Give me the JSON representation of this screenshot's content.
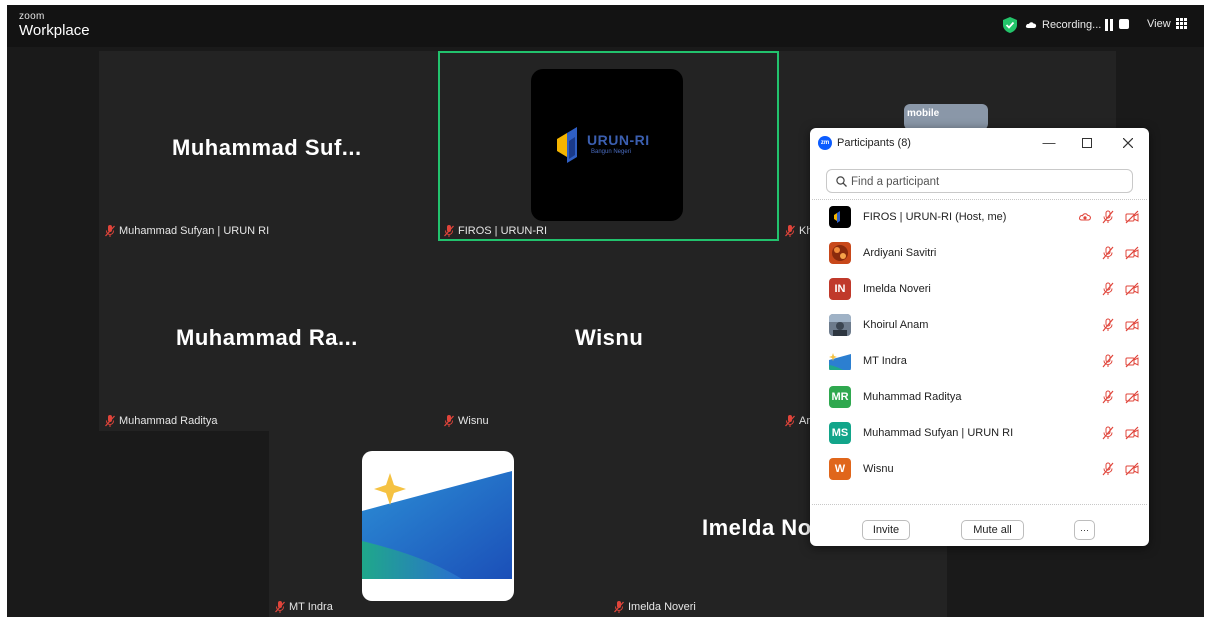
{
  "app": {
    "brand_top": "zoom",
    "brand_bottom": "Workplace",
    "recording_label": "Recording...",
    "view_label": "View"
  },
  "tiles": {
    "sufyan": {
      "display_name": "Muhammad Suf...",
      "label": "Muhammad Sufyan | URUN RI"
    },
    "firos": {
      "label": "FIROS | URUN-RI",
      "logo_text": "URUN-RI",
      "logo_sub": "Bangun Negeri"
    },
    "khoirul": {
      "label": "Kh",
      "thumb_text": "mobile"
    },
    "raditya": {
      "display_name": "Muhammad Ra...",
      "label": "Muhammad Raditya"
    },
    "wisnu": {
      "display_name": "Wisnu",
      "label": "Wisnu"
    },
    "ardiyani": {
      "label": "Ar"
    },
    "mtindra": {
      "label": "MT Indra"
    },
    "imelda": {
      "display_name": "Imelda No",
      "label": "Imelda Noveri"
    }
  },
  "panel": {
    "title": "Participants (8)",
    "app_icon_text": "zm",
    "search_placeholder": "Find a participant",
    "participants": [
      {
        "name": "FIROS | URUN-RI (Host, me)",
        "initials": "",
        "avatar_color": "#000000",
        "icons": [
          "recording-cloud-icon",
          "mic-off-icon",
          "video-off-icon"
        ]
      },
      {
        "name": "Ardiyani Savitri",
        "initials": "",
        "avatar_color": "#c8481a",
        "icons": [
          "mic-off-icon",
          "video-off-icon"
        ]
      },
      {
        "name": "Imelda Noveri",
        "initials": "IN",
        "avatar_color": "#c0392b",
        "icons": [
          "mic-off-icon",
          "video-off-icon"
        ]
      },
      {
        "name": "Khoirul Anam",
        "initials": "",
        "avatar_color": "#6d7b8c",
        "icons": [
          "mic-off-icon",
          "video-off-icon"
        ]
      },
      {
        "name": "MT Indra",
        "initials": "",
        "avatar_color": "#ffffff",
        "icons": [
          "mic-off-icon",
          "video-off-icon"
        ]
      },
      {
        "name": "Muhammad Raditya",
        "initials": "MR",
        "avatar_color": "#2fa84f",
        "icons": [
          "mic-off-icon",
          "video-off-icon"
        ]
      },
      {
        "name": "Muhammad Sufyan | URUN RI",
        "initials": "MS",
        "avatar_color": "#12a58a",
        "icons": [
          "mic-off-icon",
          "video-off-icon"
        ]
      },
      {
        "name": "Wisnu",
        "initials": "W",
        "avatar_color": "#e0661b",
        "icons": [
          "mic-off-icon",
          "video-off-icon"
        ]
      }
    ],
    "invite_label": "Invite",
    "mute_all_label": "Mute all",
    "more_label": "···"
  },
  "colors": {
    "active_speaker": "#22c26d",
    "muted_red": "#e0443a",
    "brand_blue": "#0b5cff"
  }
}
